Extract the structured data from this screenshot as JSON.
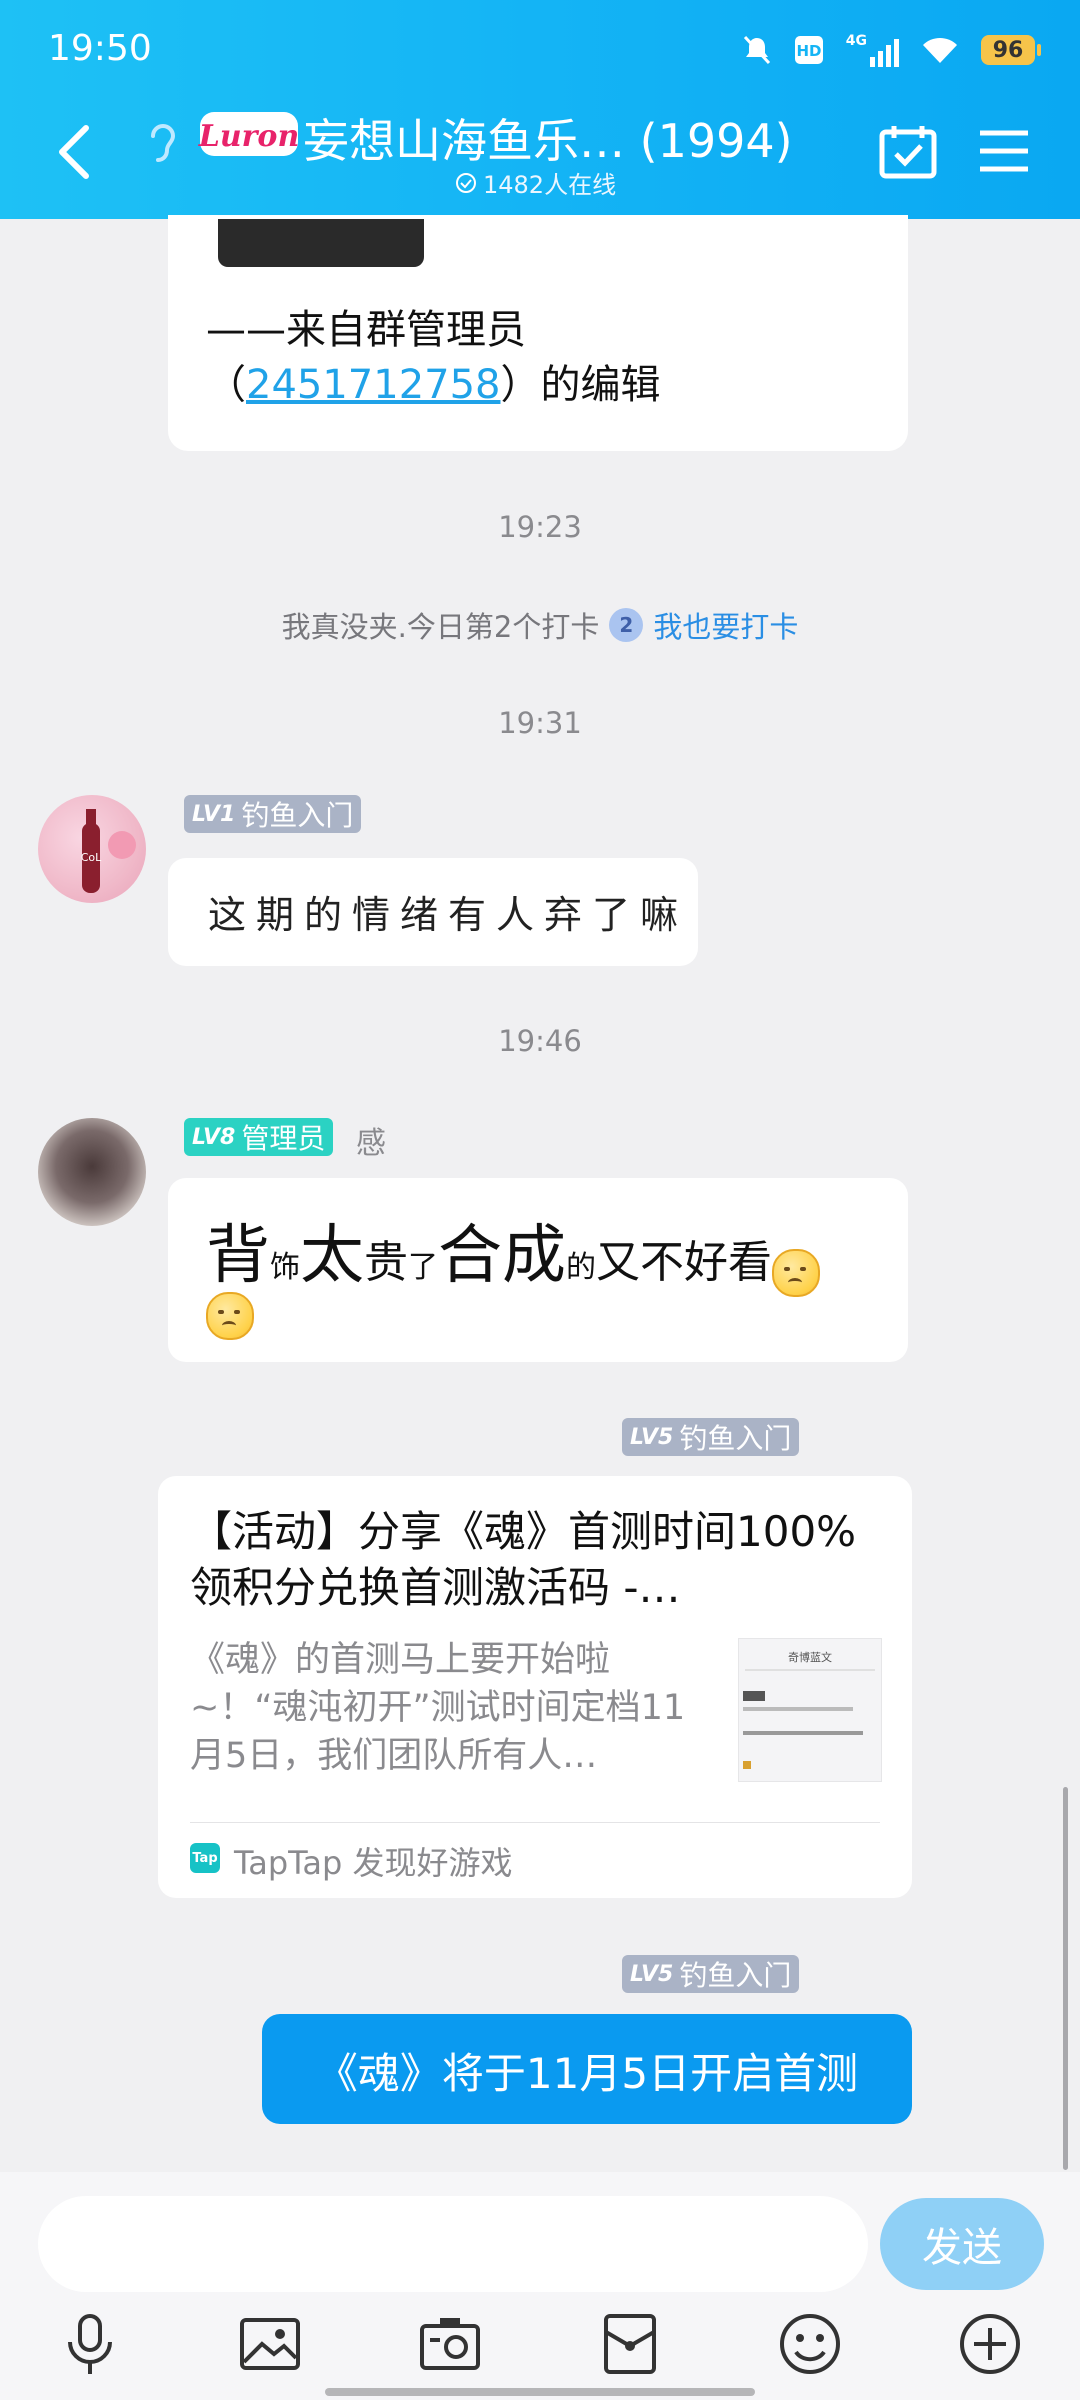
{
  "status_bar": {
    "time": "19:50",
    "network": "4G",
    "battery": "96"
  },
  "header": {
    "logo_text": "Luron",
    "title": "妄想山海鱼乐… (1994)",
    "online_count": "1482人在线"
  },
  "messages": {
    "top_card": {
      "line1": "——来自群管理员",
      "line2_prefix": "（",
      "line2_link": "2451712758",
      "line2_suffix": "）的编辑"
    },
    "ts1": "19:23",
    "checkin": {
      "text": "我真没夹.今日第2个打卡",
      "badge": "2",
      "action": "我也要打卡"
    },
    "ts2": "19:31",
    "msg2": {
      "tag_level": "LV1",
      "tag_title": "钓鱼入门",
      "text": "这期的情绪有人弃了嘛"
    },
    "ts3": "19:46",
    "msg3": {
      "tag_level": "LV8",
      "tag_title": "管理员",
      "sender": "感",
      "parts": [
        "背",
        "饰",
        "太",
        "贵",
        "了",
        "合成",
        "的",
        "又不好看"
      ]
    },
    "msg4": {
      "tag_level": "LV5",
      "tag_title": "钓鱼入门",
      "card_title": "【活动】分享《魂》首测时间100%领积分兑换首测激活码 -…",
      "card_desc": "《魂》的首测马上要开始啦~！“魂沌初开”测试时间定档11月5日，我们团队所有人…",
      "thumb_title": "奇博蓝文",
      "source_logo": "Tap",
      "source": "TapTap 发现好游戏"
    },
    "msg5": {
      "tag_level": "LV5",
      "tag_title": "钓鱼入门",
      "text": "《魂》将于11月5日开启首测"
    }
  },
  "input": {
    "placeholder": "",
    "send_label": "发送"
  },
  "toolbar": {
    "icons": [
      "mic-icon",
      "image-icon",
      "camera-icon",
      "red-packet-icon",
      "emoji-icon",
      "plus-icon"
    ]
  },
  "colors": {
    "header": "#14b4f5",
    "self_bubble": "#0a9af0",
    "link": "#20a2e8",
    "send_button": "#8fd0f6"
  }
}
